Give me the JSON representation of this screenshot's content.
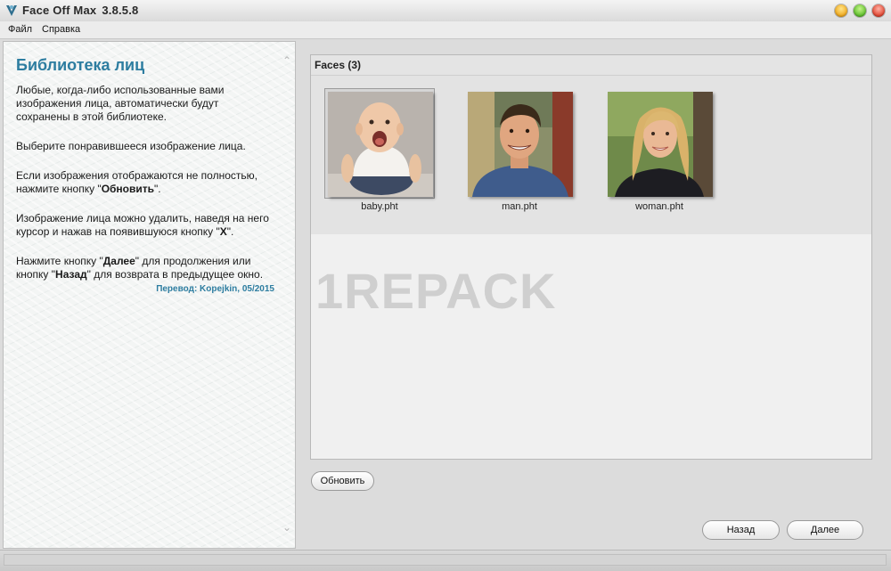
{
  "window": {
    "title": "Face Off Max",
    "version": "3.8.5.8",
    "icon": "face-off-logo-icon"
  },
  "menu": {
    "file": "Файл",
    "help": "Справка"
  },
  "sidebar": {
    "heading": "Библиотека лиц",
    "p1": "Любые, когда-либо использованные вами изображения лица, автоматически будут сохранены в этой библиотеке.",
    "p2": "Выберите понравившееся изображение лица.",
    "p3_before": "Если изображения отображаются не полностью, нажмите кнопку \"",
    "p3_bold": "Обновить",
    "p3_after": "\".",
    "p4_before": "Изображение лица можно удалить, наведя на него курсор и нажав на появившуюся кнопку \"",
    "p4_bold": "X",
    "p4_after": "\".",
    "p5_a": "Нажмите кнопку \"",
    "p5_b": "Далее",
    "p5_c": "\" для продолжения или кнопку \"",
    "p5_d": "Назад",
    "p5_e": "\" для возврата в предыдущее окно.",
    "translator": "Перевод: Kopejkin, 05/2015"
  },
  "faces": {
    "header": "Faces (3)",
    "items": [
      {
        "label": "baby.pht",
        "selected": true
      },
      {
        "label": "man.pht",
        "selected": false
      },
      {
        "label": "woman.pht",
        "selected": false
      }
    ]
  },
  "watermark": "1REPACK",
  "buttons": {
    "refresh": "Обновить",
    "back": "Назад",
    "next": "Далее"
  },
  "colors": {
    "heading": "#2d7da0",
    "window_minimize": "#f0a81c",
    "window_maximize": "#5cbd2a",
    "window_close": "#e0442f"
  }
}
